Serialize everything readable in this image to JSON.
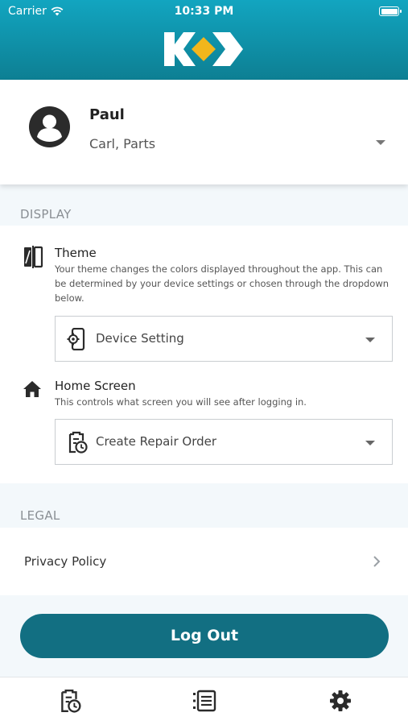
{
  "status_bar": {
    "carrier": "Carrier",
    "time": "10:33 PM"
  },
  "profile": {
    "name": "Paul",
    "role": "Carl, Parts"
  },
  "display": {
    "section_title": "DISPLAY",
    "theme": {
      "title": "Theme",
      "description": "Your theme changes the colors displayed throughout the app. This can be determined by your device settings or chosen through the dropdown below.",
      "selected": "Device Setting"
    },
    "home_screen": {
      "title": "Home Screen",
      "description": "This controls what screen you will see after logging in.",
      "selected": "Create Repair Order"
    }
  },
  "legal": {
    "section_title": "LEGAL",
    "privacy_policy": "Privacy Policy"
  },
  "logout_label": "Log Out",
  "icons": {
    "theme": "theme-contrast-icon",
    "home": "home-icon",
    "device_setting": "phone-gear-icon",
    "repair_order": "clipboard-clock-icon",
    "nav_orders": "clipboard-clock-icon",
    "nav_list": "list-icon",
    "nav_settings": "gear-icon"
  },
  "colors": {
    "header": "#0f8fa6",
    "accent": "#126f82",
    "logo_yellow": "#f2b61c"
  }
}
